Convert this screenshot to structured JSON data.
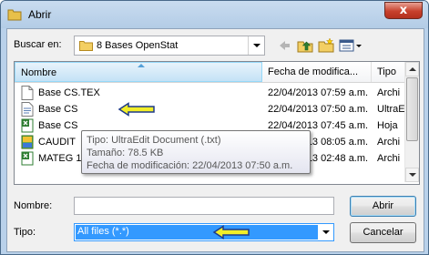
{
  "window": {
    "title": "Abrir",
    "close_glyph": "x"
  },
  "toolbar": {
    "look_in_label": "Buscar en:",
    "look_in_value": "8 Bases OpenStat",
    "back_icon": "back-arrow-icon",
    "up_icon": "up-folder-icon",
    "new_folder_icon": "new-folder-icon",
    "views_icon": "views-menu-icon"
  },
  "list": {
    "columns": [
      "Nombre",
      "Fecha de modifica...",
      "Tipo"
    ],
    "rows": [
      {
        "name": "Base CS.TEX",
        "date": "22/04/2013 07:59 a.m.",
        "type": "Archi",
        "icon": "document-icon"
      },
      {
        "name": "Base CS",
        "date": "22/04/2013 07:50 a.m.",
        "type": "UltraE",
        "icon": "text-document-icon"
      },
      {
        "name": "Base CS",
        "date": "22/04/2013 07:45 a.m.",
        "type": "Hoja",
        "icon": "excel-icon"
      },
      {
        "name": "CAUDIT",
        "date": "22/04/2013 08:05 a.m.",
        "type": "Archi",
        "icon": "image-file-icon"
      },
      {
        "name": "MATEG 1",
        "date": "22/04/2013 02:48 a.m.",
        "type": "Archi",
        "icon": "excel-icon"
      }
    ]
  },
  "tooltip": {
    "type_line": "Tipo: UltraEdit Document (.txt)",
    "size_line": "Tamaño: 78.5 KB",
    "date_line": "Fecha de modificación: 22/04/2013 07:50 a.m."
  },
  "form": {
    "name_label": "Nombre:",
    "name_value": "",
    "type_label": "Tipo:",
    "type_value": "All files (*.*)"
  },
  "buttons": {
    "open": "Abrir",
    "cancel": "Cancelar"
  },
  "colors": {
    "selection": "#3399ff",
    "annotation_arrow": "#f2ee28"
  }
}
